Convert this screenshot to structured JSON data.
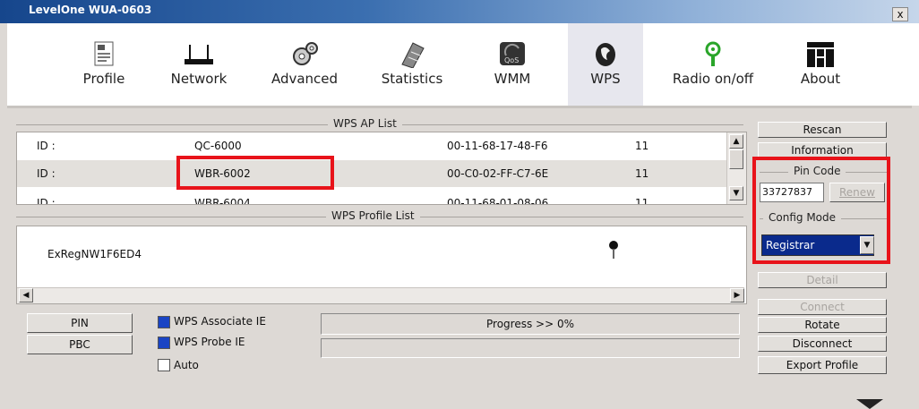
{
  "window": {
    "title": "LevelOne WUA-0603",
    "close_glyph": "x"
  },
  "toolbar": {
    "items": [
      {
        "label": "Profile",
        "icon": "profile-icon"
      },
      {
        "label": "Network",
        "icon": "network-icon"
      },
      {
        "label": "Advanced",
        "icon": "gear-icon"
      },
      {
        "label": "Statistics",
        "icon": "statistics-icon"
      },
      {
        "label": "WMM",
        "icon": "wmm-icon"
      },
      {
        "label": "WPS",
        "icon": "wps-icon",
        "active": true
      },
      {
        "label": "Radio on/off",
        "icon": "radio-icon"
      },
      {
        "label": "About",
        "icon": "about-icon"
      }
    ],
    "wmm_badge": "QoS"
  },
  "wps_ap_list": {
    "title": "WPS AP List",
    "rows": [
      {
        "id_label": "ID :",
        "name": "QC-6000",
        "mac": "00-11-68-17-48-F6",
        "channel": "11"
      },
      {
        "id_label": "ID :",
        "name": "WBR-6002",
        "mac": "00-C0-02-FF-C7-6E",
        "channel": "11",
        "selected": true
      },
      {
        "id_label": "ID :",
        "name": "WBR-6004",
        "mac": "00-11-68-01-08-06",
        "channel": "11"
      }
    ]
  },
  "wps_profile_list": {
    "title": "WPS Profile List",
    "rows": [
      {
        "name": "ExRegNW1F6ED4"
      }
    ]
  },
  "buttons": {
    "pin": "PIN",
    "pbc": "PBC",
    "rescan": "Rescan",
    "information": "Information",
    "renew": "Renew",
    "detail": "Detail",
    "connect": "Connect",
    "rotate": "Rotate",
    "disconnect": "Disconnect",
    "export_profile": "Export Profile"
  },
  "checkboxes": {
    "wps_associate_ie": {
      "label": "WPS Associate IE",
      "checked": true
    },
    "wps_probe_ie": {
      "label": "WPS Probe IE",
      "checked": true
    },
    "auto": {
      "label": "Auto",
      "checked": false
    }
  },
  "progress": {
    "text": "Progress >> 0%",
    "percent": 0
  },
  "pin_code": {
    "label": "Pin Code",
    "value": "33727837"
  },
  "config_mode": {
    "label": "Config Mode",
    "selected": "Registrar"
  },
  "colors": {
    "highlight_box": "#e8131a",
    "select_bg": "#0a2a8c",
    "title_bar": "#16468c"
  }
}
